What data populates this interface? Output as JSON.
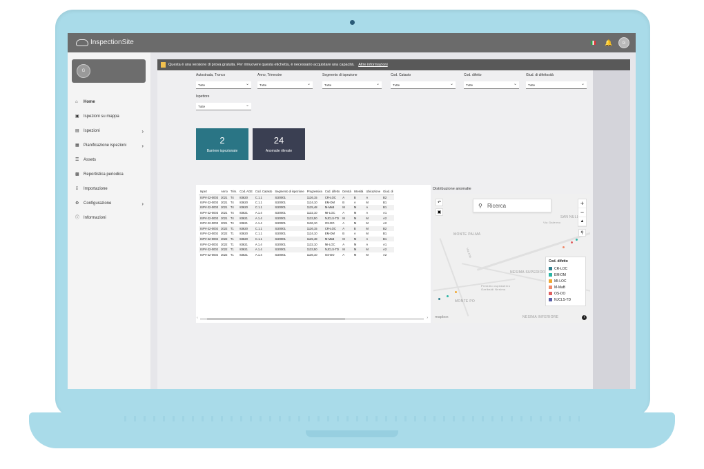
{
  "topbar": {
    "logo_text": "InspectionSite",
    "avatar_initial": "G"
  },
  "sidebar": {
    "user_initial": "G",
    "items": [
      {
        "label": "Home",
        "icon": "home-icon",
        "active": true
      },
      {
        "label": "Ispezioni su mappa",
        "icon": "map-icon"
      },
      {
        "label": "Ispezioni",
        "icon": "clipboard-icon",
        "chevron": true
      },
      {
        "label": "Pianificazione ispezioni",
        "icon": "calendar-icon",
        "chevron": true
      },
      {
        "label": "Assets",
        "icon": "list-icon"
      },
      {
        "label": "Reportistica periodica",
        "icon": "report-icon"
      },
      {
        "label": "Importazione",
        "icon": "import-icon"
      },
      {
        "label": "Configurazione",
        "icon": "gear-icon",
        "chevron": true
      },
      {
        "label": "Informazioni",
        "icon": "info-icon"
      }
    ]
  },
  "trial": {
    "message": "Questa è una versione di prova gratuita. Per rimuovere questa etichetta, è necessario acquistare una capacità.",
    "link": "Altre informazioni"
  },
  "filters": [
    {
      "label": "Autostrada, Tronco",
      "value": "Tutte"
    },
    {
      "label": "Anno, Trimestre",
      "value": "Tutte"
    },
    {
      "label": "Segmento di ispezione",
      "value": "Tutte"
    },
    {
      "label": "Cod. Catasto",
      "value": "Tutte"
    },
    {
      "label": "Cod. difetto",
      "value": "Tutte"
    },
    {
      "label": "Giud. di difettosità",
      "value": "Tutte"
    },
    {
      "label": "Ispettore",
      "value": "Tutte"
    }
  ],
  "cards": [
    {
      "value": "2",
      "caption": "Barriere ispezionate",
      "color": "#2a7585"
    },
    {
      "value": "24",
      "caption": "Anomalie rilevate",
      "color": "#3a3f52"
    }
  ],
  "table": {
    "columns": [
      "Ispez",
      "Anno",
      "Trim.",
      "Cod. AGE",
      "Cod. Catasto",
      "Segmento di ispezione",
      "Progressiva",
      "Cod. difetto",
      "Derotà",
      "Intesità",
      "Ubicazione",
      "Giud. di"
    ],
    "rows": [
      [
        "ISPV-22-0003",
        "2021",
        "T4",
        "83620",
        "C.1.1",
        "SI20001",
        "1126,15",
        "CR-LOC",
        "A",
        "B",
        "A",
        "B2"
      ],
      [
        "ISPV-22-0003",
        "2021",
        "T4",
        "83620",
        "C.1.1",
        "SI20001",
        "1124,10",
        "EM-DM",
        "B",
        "A",
        "M",
        "B1"
      ],
      [
        "ISPV-22-0003",
        "2021",
        "T4",
        "83620",
        "C.1.1",
        "SI20001",
        "1125,48",
        "M-MaB",
        "M",
        "M",
        "A",
        "B1"
      ],
      [
        "ISPV-22-0003",
        "2021",
        "T4",
        "83621",
        "A.1.4",
        "SI20001",
        "1132,10",
        "MI-LOC",
        "A",
        "M",
        "A",
        "A1"
      ],
      [
        "ISPV-22-0003",
        "2021",
        "T4",
        "83621",
        "A.1.4",
        "SI20001",
        "1133,50",
        "NJCLS-TD",
        "M",
        "M",
        "M",
        "A2"
      ],
      [
        "ISPV-22-0003",
        "2021",
        "T4",
        "83621",
        "A.1.4",
        "SI20001",
        "1136,10",
        "OS-DO",
        "A",
        "M",
        "M",
        "A2"
      ],
      [
        "ISPV-22-0002",
        "2022",
        "T1",
        "83620",
        "C.1.1",
        "SI20001",
        "1126,15",
        "CR-LOC",
        "A",
        "B",
        "M",
        "B2"
      ],
      [
        "ISPV-22-0002",
        "2022",
        "T1",
        "83620",
        "C.1.1",
        "SI20001",
        "1124,10",
        "EM-DM",
        "B",
        "A",
        "M",
        "B1"
      ],
      [
        "ISPV-22-0002",
        "2022",
        "T1",
        "83620",
        "C.1.1",
        "SI20001",
        "1125,48",
        "M-MaB",
        "M",
        "M",
        "A",
        "B1"
      ],
      [
        "ISPV-22-0002",
        "2022",
        "T1",
        "83621",
        "A.1.4",
        "SI20001",
        "1132,10",
        "MI-LOC",
        "A",
        "M",
        "A",
        "A1"
      ],
      [
        "ISPV-22-0002",
        "2022",
        "T1",
        "83621",
        "A.1.4",
        "SI20001",
        "1133,50",
        "NJCLS-TD",
        "M",
        "M",
        "M",
        "A2"
      ],
      [
        "ISPV-22-0002",
        "2022",
        "T1",
        "83621",
        "A.1.4",
        "SI20001",
        "1136,10",
        "OS-DO",
        "A",
        "M",
        "M",
        "A2"
      ]
    ]
  },
  "map": {
    "title": "Distribuzione anomalie",
    "search_placeholder": "Ricerca",
    "attribution": "mapbox",
    "place_labels": [
      "MONTE PALMA",
      "NESIMA SUPERIORE",
      "Presidio ospedaliero Garibaldi Nesima",
      "MONTE PO",
      "NESIMA INFERIORE",
      "SAN NULLO",
      "Via Lisi",
      "Via Galermo"
    ],
    "legend": {
      "title": "Cod. difetto",
      "items": [
        {
          "label": "CR-LOC",
          "color": "#2e7d8c"
        },
        {
          "label": "EM-DM",
          "color": "#2bb5a5"
        },
        {
          "label": "MI-LOC",
          "color": "#f0a830"
        },
        {
          "label": "M-MaB",
          "color": "#f08a6a"
        },
        {
          "label": "OS-DO",
          "color": "#e06060"
        },
        {
          "label": "NJCLS-TD",
          "color": "#5a60a8"
        }
      ]
    }
  }
}
